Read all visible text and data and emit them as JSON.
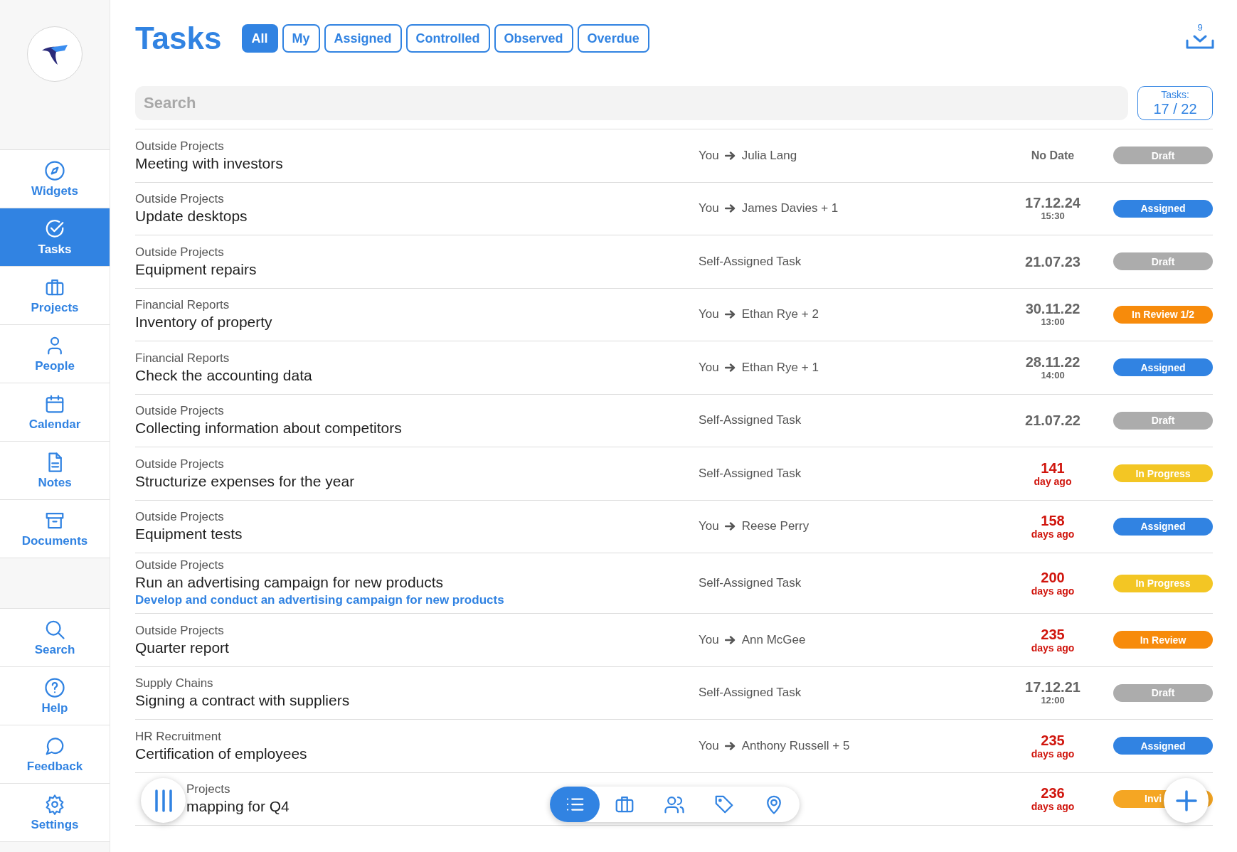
{
  "sidebar": {
    "items": [
      {
        "label": "Widgets",
        "selected": false
      },
      {
        "label": "Tasks",
        "selected": true
      },
      {
        "label": "Projects",
        "selected": false
      },
      {
        "label": "People",
        "selected": false
      },
      {
        "label": "Calendar",
        "selected": false
      },
      {
        "label": "Notes",
        "selected": false
      },
      {
        "label": "Documents",
        "selected": false
      }
    ],
    "bottom_items": [
      {
        "label": "Search",
        "selected": false
      },
      {
        "label": "Help",
        "selected": false
      },
      {
        "label": "Feedback",
        "selected": false
      },
      {
        "label": "Settings",
        "selected": false
      }
    ]
  },
  "header": {
    "title": "Tasks",
    "filters": [
      {
        "label": "All",
        "selected": true
      },
      {
        "label": "My",
        "selected": false
      },
      {
        "label": "Assigned",
        "selected": false
      },
      {
        "label": "Controlled",
        "selected": false
      },
      {
        "label": "Observed",
        "selected": false
      },
      {
        "label": "Overdue",
        "selected": false
      }
    ],
    "download_count": "9"
  },
  "search": {
    "placeholder": "Search"
  },
  "task_count": {
    "label": "Tasks:",
    "value": "17 / 22"
  },
  "rows": [
    {
      "category": "Outside Projects",
      "title": "Meeting with investors",
      "assigner": "You",
      "assignee": "Julia Lang",
      "kind": "none",
      "date": "No Date",
      "status": "Draft",
      "color": "#acacac"
    },
    {
      "category": "Outside Projects",
      "title": "Update desktops",
      "assigner": "You",
      "assignee": "James Davies + 1",
      "kind": "date",
      "date": "17.12.24",
      "time": "15:30",
      "status": "Assigned",
      "color": "#3183e2"
    },
    {
      "category": "Outside Projects",
      "title": "Equipment repairs",
      "assignment": "Self-Assigned Task",
      "kind": "date",
      "date": "21.07.23",
      "status": "Draft",
      "color": "#acacac"
    },
    {
      "category": "Financial Reports",
      "title": "Inventory of property",
      "assigner": "You",
      "assignee": "Ethan Rye + 2",
      "kind": "date",
      "date": "30.11.22",
      "time": "13:00",
      "status": "In Review 1/2",
      "color": "#f78b0b"
    },
    {
      "category": "Financial Reports",
      "title": "Check the accounting data",
      "assigner": "You",
      "assignee": "Ethan Rye + 1",
      "kind": "date",
      "date": "28.11.22",
      "time": "14:00",
      "status": "Assigned",
      "color": "#3183e2"
    },
    {
      "category": "Outside Projects",
      "title": "Collecting information about competitors",
      "assignment": "Self-Assigned Task",
      "kind": "date",
      "date": "21.07.22",
      "status": "Draft",
      "color": "#acacac"
    },
    {
      "category": "Outside Projects",
      "title": "Structurize expenses for the year",
      "assignment": "Self-Assigned Task",
      "kind": "overdue",
      "date": "141",
      "time": "day ago",
      "status": "In Progress",
      "color": "#f3c624"
    },
    {
      "category": "Outside Projects",
      "title": "Equipment tests",
      "assigner": "You",
      "assignee": "Reese Perry",
      "kind": "overdue",
      "date": "158",
      "time": "days ago",
      "status": "Assigned",
      "color": "#3183e2"
    },
    {
      "category": "Outside Projects",
      "title": "Run an advertising campaign for new products",
      "description": "Develop and conduct an advertising campaign for new products",
      "assignment": "Self-Assigned Task",
      "kind": "overdue",
      "date": "200",
      "time": "days ago",
      "status": "In Progress",
      "color": "#f3c624"
    },
    {
      "category": "Outside Projects",
      "title": "Quarter report",
      "assigner": "You",
      "assignee": "Ann McGee",
      "kind": "overdue",
      "date": "235",
      "time": "days ago",
      "status": "In Review",
      "color": "#f78b0b"
    },
    {
      "category": "Supply Chains",
      "title": "Signing a contract with suppliers",
      "assignment": "Self-Assigned Task",
      "kind": "date",
      "date": "17.12.21",
      "time": "12:00",
      "status": "Draft",
      "color": "#acacac"
    },
    {
      "category": "HR Recruitment",
      "title": "Certification of employees",
      "assigner": "You",
      "assignee": "Anthony Russell + 5",
      "kind": "overdue",
      "date": "235",
      "time": "days ago",
      "status": "Assigned",
      "color": "#3183e2"
    },
    {
      "category": "Projects",
      "title": "mapping for Q4",
      "partly_covered": true,
      "kind": "overdue",
      "date": "236",
      "time": "days ago",
      "status": "Invi",
      "color": "#f5a623"
    }
  ],
  "bottom_toolbar": {
    "items": [
      {
        "selected": true
      },
      {
        "selected": false
      },
      {
        "selected": false
      },
      {
        "selected": false
      },
      {
        "selected": false
      }
    ]
  }
}
